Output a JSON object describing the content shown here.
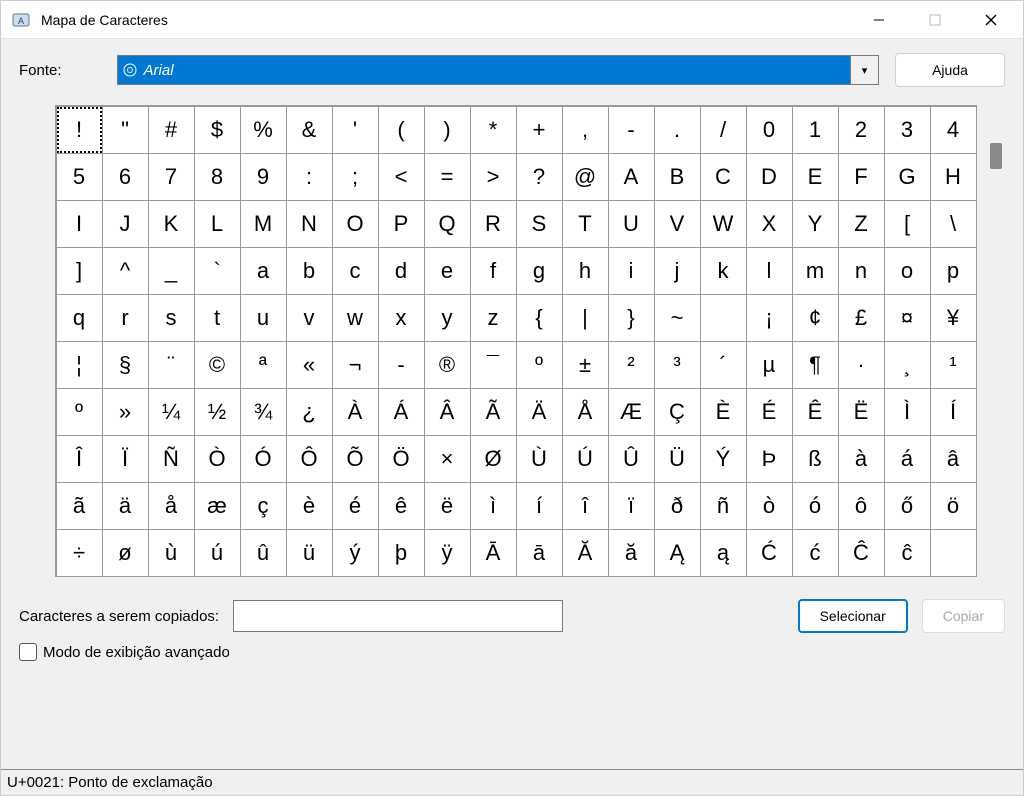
{
  "window": {
    "title": "Mapa de Caracteres"
  },
  "labels": {
    "font": "Fonte:",
    "help": "Ajuda",
    "copy_to": "Caracteres a serem copiados:",
    "select": "Selecionar",
    "copy": "Copiar",
    "advanced": "Modo de exibição avançado"
  },
  "font_select": {
    "value": "Arial"
  },
  "copy_input": {
    "value": ""
  },
  "statusbar": {
    "text": "U+0021: Ponto de exclamação"
  },
  "grid": {
    "columns": 20,
    "selected_index": 0,
    "chars": [
      "!",
      "\"",
      "#",
      "$",
      "%",
      "&",
      "'",
      "(",
      ")",
      "*",
      "+",
      ",",
      "-",
      ".",
      "/",
      "0",
      "1",
      "2",
      "3",
      "4",
      "5",
      "6",
      "7",
      "8",
      "9",
      ":",
      ";",
      "<",
      "=",
      ">",
      "?",
      "@",
      "A",
      "B",
      "C",
      "D",
      "E",
      "F",
      "G",
      "H",
      "I",
      "J",
      "K",
      "L",
      "M",
      "N",
      "O",
      "P",
      "Q",
      "R",
      "S",
      "T",
      "U",
      "V",
      "W",
      "X",
      "Y",
      "Z",
      "[",
      "\\",
      "]",
      "^",
      "_",
      "`",
      "a",
      "b",
      "c",
      "d",
      "e",
      "f",
      "g",
      "h",
      "i",
      "j",
      "k",
      "l",
      "m",
      "n",
      "o",
      "p",
      "q",
      "r",
      "s",
      "t",
      "u",
      "v",
      "w",
      "x",
      "y",
      "z",
      "{",
      "|",
      "}",
      "~",
      " ",
      "¡",
      "¢",
      "£",
      "¤",
      "¥",
      "¦",
      "§",
      "¨",
      "©",
      "ª",
      "«",
      "¬",
      "-",
      "®",
      "¯",
      "º",
      "±",
      "²",
      "³",
      "´",
      "µ",
      "¶",
      "·",
      "¸",
      "¹",
      "º",
      "»",
      "¼",
      "½",
      "¾",
      "¿",
      "À",
      "Á",
      "Â",
      "Ã",
      "Ä",
      "Å",
      "Æ",
      "Ç",
      "È",
      "É",
      "Ê",
      "Ë",
      "Ì",
      "Í",
      "Î",
      "Ï",
      "Ñ",
      "Ò",
      "Ó",
      "Ô",
      "Õ",
      "Ö",
      "×",
      "Ø",
      "Ù",
      "Ú",
      "Û",
      "Ü",
      "Ý",
      "Þ",
      "ß",
      "à",
      "á",
      "â",
      "ã",
      "ä",
      "å",
      "æ",
      "ç",
      "è",
      "é",
      "ê",
      "ë",
      "ì",
      "í",
      "î",
      "ï",
      "ð",
      "ñ",
      "ò",
      "ó",
      "ô",
      "ő",
      "ö",
      "÷",
      "ø",
      "ù",
      "ú",
      "û",
      "ü",
      "ý",
      "þ",
      "ÿ",
      "Ā",
      "ā",
      "Ă",
      "ă",
      "Ą",
      "ą",
      "Ć",
      "ć",
      "Ĉ",
      "ĉ"
    ]
  }
}
